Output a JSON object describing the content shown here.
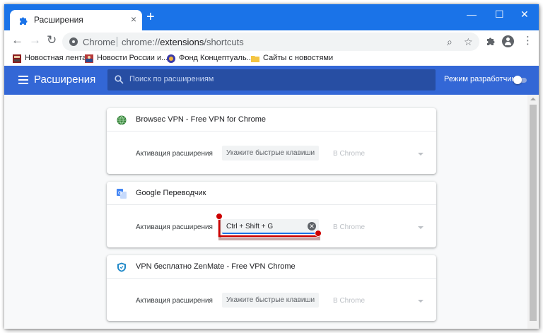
{
  "tab": {
    "title": "Расширения",
    "close": "×",
    "new_tab": "+"
  },
  "window_controls": {
    "minimize": "—",
    "maximize": "☐",
    "close": "✕"
  },
  "toolbar": {
    "back": "←",
    "forward": "→",
    "reload": "↻",
    "site": "Chrome",
    "url_prefix": "chrome://",
    "url_host": "extensions",
    "url_path": "/shortcuts",
    "search_glyph": "⌕",
    "star_glyph": "☆",
    "menu_glyph": "⋮"
  },
  "bookmarks": [
    {
      "label": "Новостная лента",
      "icon": "news-feed-icon"
    },
    {
      "label": "Новости России и...",
      "icon": "russia-news-icon"
    },
    {
      "label": "Фонд Концептуаль...",
      "icon": "fund-icon"
    },
    {
      "label": "Сайты с новостями",
      "icon": "folder-icon"
    }
  ],
  "header": {
    "title": "Расширения",
    "search_placeholder": "Поиск по расширениям",
    "dev_mode_label": "Режим разработчика",
    "dev_mode_on": false
  },
  "extensions": [
    {
      "name": "Browsec VPN - Free VPN for Chrome",
      "icon": "globe-icon",
      "action_label": "Активация расширения",
      "shortcut": "Укажите быстрые клавиши",
      "shortcut_set": false,
      "scope": "В Chrome"
    },
    {
      "name": "Google Переводчик",
      "icon": "translate-icon",
      "action_label": "Активация расширения",
      "shortcut": "Ctrl + Shift + G",
      "shortcut_set": true,
      "scope": "В Chrome"
    },
    {
      "name": "VPN бесплатно ZenMate - Free VPN Chrome",
      "icon": "shield-icon",
      "action_label": "Активация расширения",
      "shortcut": "Укажите быстрые клавиши",
      "shortcut_set": false,
      "scope": "В Chrome"
    }
  ],
  "colors": {
    "title_bar": "#1a73e8",
    "ext_header": "#3367d6",
    "annotation": "#cc0000"
  }
}
